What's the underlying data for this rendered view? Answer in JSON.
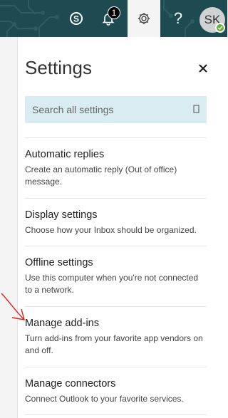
{
  "topbar": {
    "notification_count": "1",
    "avatar_initials": "SK",
    "help_glyph": "?",
    "background_color": "#1e4a52",
    "icons": [
      "skype-icon",
      "bell-icon",
      "gear-icon",
      "help-icon"
    ]
  },
  "settings": {
    "title": "Settings",
    "search_placeholder": "Search all settings",
    "items": [
      {
        "title": "Automatic replies",
        "description": "Create an automatic reply (Out of office) message."
      },
      {
        "title": "Display settings",
        "description": "Choose how your Inbox should be organized."
      },
      {
        "title": "Offline settings",
        "description": "Use this computer when you're not connected to a network."
      },
      {
        "title": "Manage add-ins",
        "description": "Turn add-ins from your favorite app vendors on and off."
      },
      {
        "title": "Manage connectors",
        "description": "Connect Outlook to your favorite services."
      }
    ]
  }
}
